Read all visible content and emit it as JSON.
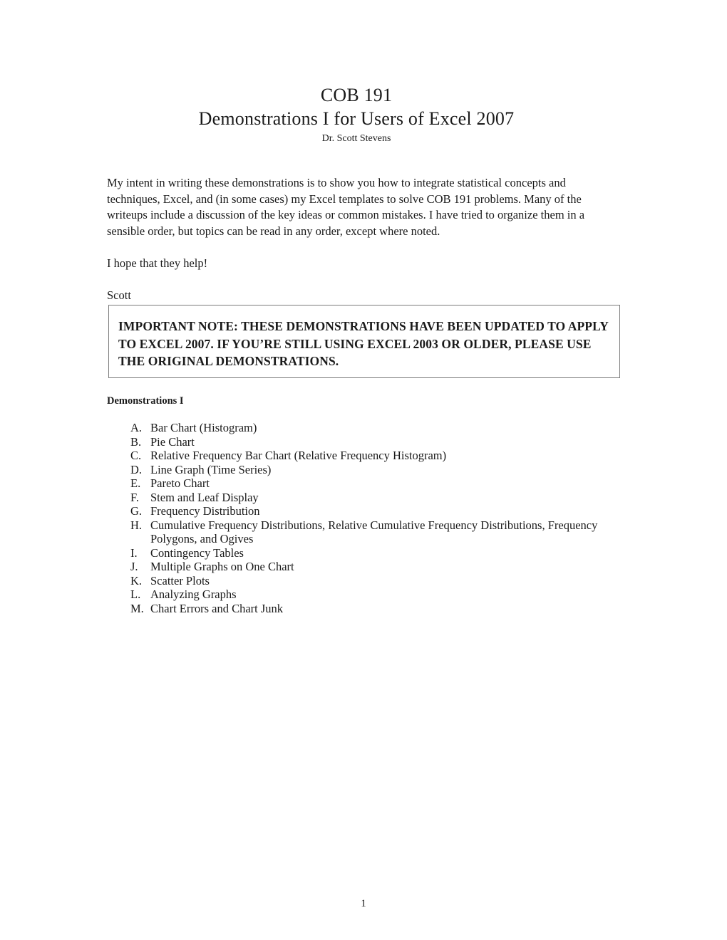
{
  "document": {
    "title_line1": "COB 191",
    "title_line2": "Demonstrations I for Users of Excel 2007",
    "byline": "Dr. Scott Stevens",
    "page_number": "1"
  },
  "intro": {
    "paragraph1": "My intent in writing these demonstrations is to show you how to integrate statistical concepts and techniques, Excel, and (in some cases) my Excel templates to solve COB 191 problems.  Many of the writeups include a discussion of the key ideas or common mistakes.  I have tried to organize them in a sensible order, but topics can be read in any order, except where noted.",
    "paragraph2": "I hope that they help!",
    "signature": "Scott"
  },
  "note_box": {
    "text": "IMPORTANT NOTE:  THESE DEMONSTRATIONS HAVE BEEN UPDATED TO APPLY TO EXCEL 2007.  IF YOU’RE STILL USING EXCEL 2003 OR OLDER, PLEASE USE THE ORIGINAL DEMONSTRATIONS.",
    "border_color": "#7a7a7a"
  },
  "demonstrations": {
    "heading": "Demonstrations I",
    "items": [
      {
        "marker": "A.",
        "label": "Bar Chart (Histogram)"
      },
      {
        "marker": "B.",
        "label": "Pie Chart"
      },
      {
        "marker": "C.",
        "label": "Relative Frequency Bar Chart (Relative Frequency Histogram)"
      },
      {
        "marker": "D.",
        "label": "Line Graph (Time Series)"
      },
      {
        "marker": "E.",
        "label": "Pareto Chart"
      },
      {
        "marker": "F.",
        "label": "Stem and Leaf Display"
      },
      {
        "marker": "G.",
        "label": "Frequency Distribution"
      },
      {
        "marker": "H.",
        "label": "Cumulative Frequency Distributions, Relative Cumulative Frequency Distributions, Frequency Polygons, and Ogives"
      },
      {
        "marker": "I.",
        "label": "Contingency Tables"
      },
      {
        "marker": "J.",
        "label": "Multiple Graphs on One Chart"
      },
      {
        "marker": "K.",
        "label": "Scatter Plots"
      },
      {
        "marker": "L.",
        "label": "Analyzing Graphs"
      },
      {
        "marker": "M.",
        "label": "Chart Errors and Chart Junk"
      }
    ]
  }
}
